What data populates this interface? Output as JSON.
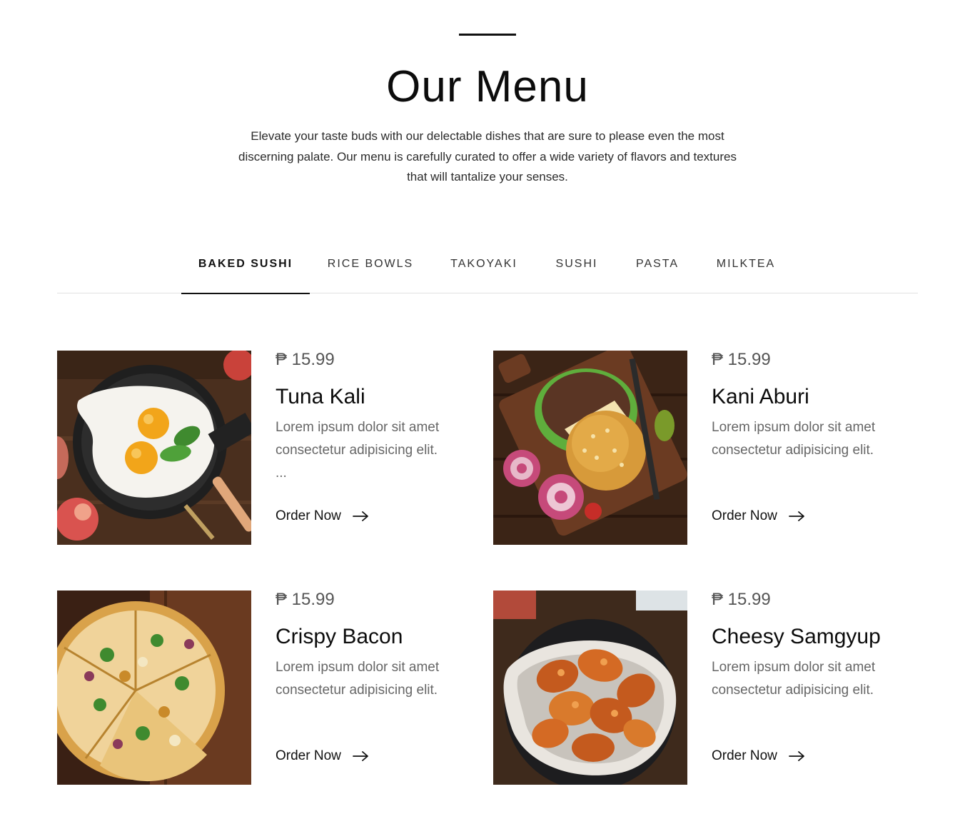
{
  "header": {
    "title": "Our Menu",
    "intro": "Elevate your taste buds with our delectable dishes that are sure to please even the most discerning palate. Our menu is carefully curated to offer a wide variety of flavors and textures that will tantalize your senses."
  },
  "tabs": [
    {
      "label": "BAKED SUSHI",
      "active": true
    },
    {
      "label": "RICE BOWLS",
      "active": false
    },
    {
      "label": "TAKOYAKI",
      "active": false
    },
    {
      "label": "SUSHI",
      "active": false
    },
    {
      "label": "PASTA",
      "active": false
    },
    {
      "label": "MILKTEA",
      "active": false
    }
  ],
  "items": [
    {
      "price": "₱ 15.99",
      "name": "Tuna Kali",
      "description": "Lorem ipsum dolor sit amet consectetur adipisicing elit. ...",
      "cta": "Order Now",
      "image": "fried-eggs-in-pan"
    },
    {
      "price": "₱ 15.99",
      "name": "Kani Aburi",
      "description": "Lorem ipsum dolor sit amet consectetur adipisicing elit.",
      "cta": "Order Now",
      "image": "burger-on-board"
    },
    {
      "price": "₱ 15.99",
      "name": "Crispy Bacon",
      "description": "Lorem ipsum dolor sit amet consectetur adipisicing elit.",
      "cta": "Order Now",
      "image": "pizza-on-board"
    },
    {
      "price": "₱ 15.99",
      "name": "Cheesy Samgyup",
      "description": "Lorem ipsum dolor sit amet consectetur adipisicing elit.",
      "cta": "Order Now",
      "image": "chicken-wings-bowl"
    }
  ],
  "colors": {
    "text": "#0c0c0c",
    "muted": "#666666",
    "price": "#555555",
    "divider": "#e1e1e1"
  }
}
